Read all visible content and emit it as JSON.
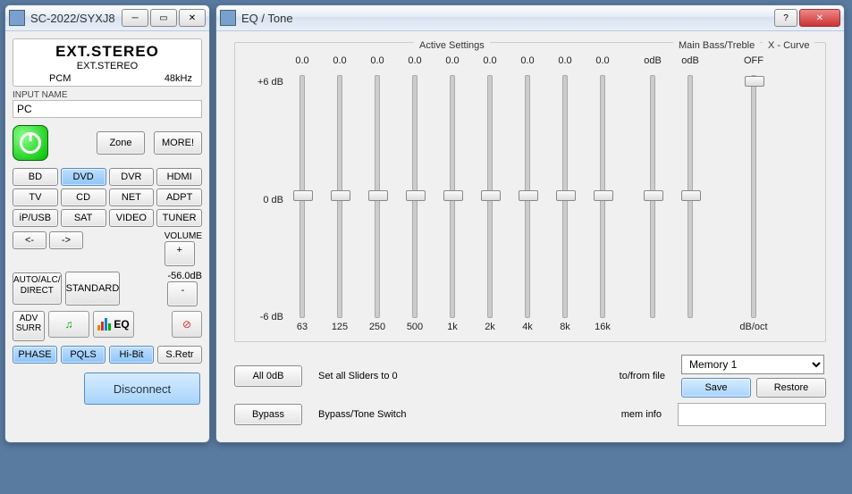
{
  "left_window": {
    "title": "SC-2022/SYXJ8",
    "display": {
      "main": "EXT.STEREO",
      "sub": "EXT.STEREO",
      "codec": "PCM",
      "sample_rate": "48kHz"
    },
    "input_name_label": "INPUT NAME",
    "input_name_value": "PC",
    "zone_btn": "Zone",
    "more_btn": "MORE!",
    "sources": {
      "bd": "BD",
      "dvd": "DVD",
      "dvr": "DVR",
      "hdmi": "HDMI",
      "tv": "TV",
      "cd": "CD",
      "net": "NET",
      "adpt": "ADPT",
      "ipusb": "iP/USB",
      "sat": "SAT",
      "video": "VIDEO",
      "tuner": "TUNER"
    },
    "nav": {
      "prev": "<-",
      "next": "->"
    },
    "volume_label": "VOLUME",
    "volume_value": "-56.0dB",
    "vol_plus": "+",
    "vol_minus": "-",
    "auto_btn": "AUTO/ALC/ DIRECT",
    "standard_btn": "STANDARD",
    "advsurr_btn": "ADV SURR",
    "eq_btn": "EQ",
    "phase": "PHASE",
    "pqls": "PQLS",
    "hibit": "Hi-Bit",
    "sretr": "S.Retr",
    "disconnect": "Disconnect"
  },
  "right_window": {
    "title": "EQ / Tone",
    "section_active": "Active Settings",
    "section_tone": "Main Bass/Treble",
    "section_xcurve": "X - Curve",
    "y_max": "+6 dB",
    "y_mid": "0 dB",
    "y_min": "-6 dB",
    "eq_bands": [
      {
        "val": "0.0",
        "freq": "63"
      },
      {
        "val": "0.0",
        "freq": "125"
      },
      {
        "val": "0.0",
        "freq": "250"
      },
      {
        "val": "0.0",
        "freq": "500"
      },
      {
        "val": "0.0",
        "freq": "1k"
      },
      {
        "val": "0.0",
        "freq": "2k"
      },
      {
        "val": "0.0",
        "freq": "4k"
      },
      {
        "val": "0.0",
        "freq": "8k"
      },
      {
        "val": "0.0",
        "freq": "16k"
      }
    ],
    "tone": [
      {
        "val": "odB",
        "freq": ""
      },
      {
        "val": "odB",
        "freq": ""
      }
    ],
    "xcurve": {
      "val": "OFF",
      "foot": "dB/oct"
    },
    "xcurve_thumb_top": 0,
    "all0_btn": "All 0dB",
    "all0_desc": "Set all Sliders to 0",
    "tofrom": "to/from file",
    "bypass_btn": "Bypass",
    "bypass_desc": "Bypass/Tone Switch",
    "meminfo": "mem info",
    "memory_selected": "Memory 1",
    "save_btn": "Save",
    "restore_btn": "Restore"
  }
}
